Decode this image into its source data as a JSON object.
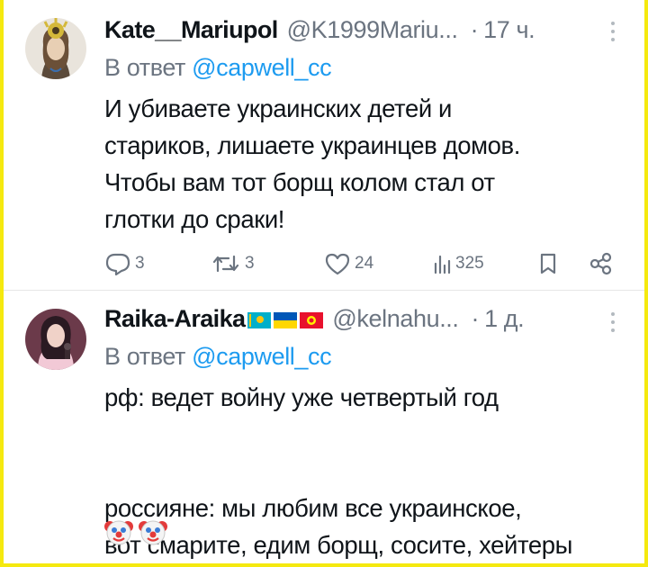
{
  "tweets": [
    {
      "author_name": "Kate__Mariupol",
      "handle": "@K1999Mariu...",
      "time": "17 ч.",
      "reply_prefix": "В ответ",
      "reply_mention": "@capwell_cc",
      "text": "И убиваете украинских детей и\nстариков, лишаете украинцев домов.\nЧтобы вам тот борщ колом стал от\nглотки до сраки!",
      "actions": {
        "replies": "3",
        "retweets": "3",
        "likes": "24",
        "views": "325"
      }
    },
    {
      "author_name": "Raika-Araika",
      "handle": "@kelnahu...",
      "time": "1 д.",
      "reply_prefix": "В ответ",
      "reply_mention": "@capwell_cc",
      "text": "рф: ведет войну уже четвертый год\n\n\nроссияне: мы любим все украинское,\nвот смарите, едим борщ, сосите, хейтеры",
      "emojis": [
        "clown-face",
        "clown-face"
      ],
      "flags": [
        "Kazakhstan",
        "Ukraine",
        "Kyrgyzstan"
      ]
    }
  ],
  "colors": {
    "background_border": "#f5e90f",
    "text": "#0f1419",
    "secondary": "#6b7480",
    "link": "#1d9bf0"
  }
}
